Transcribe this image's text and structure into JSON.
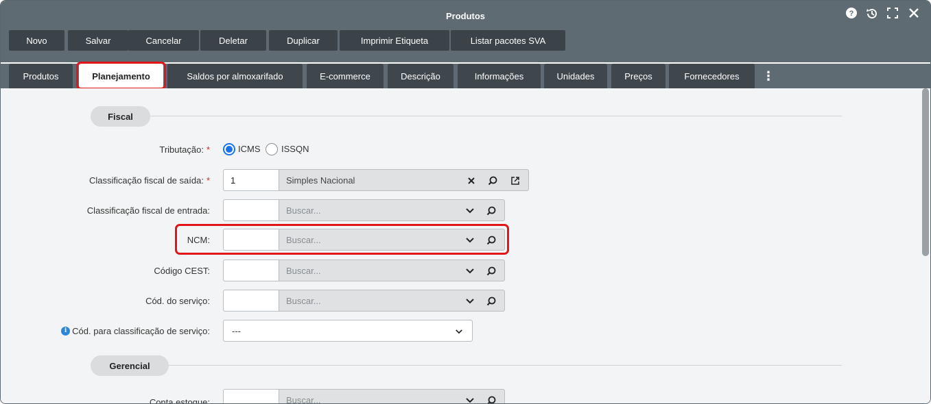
{
  "window": {
    "title": "Produtos"
  },
  "window_controls": [
    "help-icon",
    "history-icon",
    "fullscreen-icon",
    "close-icon"
  ],
  "toolbar": {
    "buttons": [
      "Novo",
      "Salvar",
      "Cancelar",
      "Deletar",
      "Duplicar",
      "Imprimir Etiqueta",
      "Listar pacotes SVA"
    ]
  },
  "tabs": {
    "items": [
      "Produtos",
      "Planejamento",
      "Saldos por almoxarifado",
      "E-commerce",
      "Descrição",
      "Informações",
      "Unidades",
      "Preços",
      "Fornecedores"
    ],
    "active": "Planejamento",
    "more": "⋮"
  },
  "sections": {
    "fiscal": "Fiscal",
    "gerencial": "Gerencial"
  },
  "fields": {
    "tributacao": {
      "label": "Tributação:",
      "required": "*",
      "options": [
        "ICMS",
        "ISSQN"
      ],
      "selected": "ICMS"
    },
    "class_saida": {
      "label": "Classificação fiscal de saída:",
      "required": "*",
      "code": "1",
      "value": "Simples Nacional"
    },
    "class_entrada": {
      "label": "Classificação fiscal de entrada:",
      "code": "",
      "placeholder": "Buscar..."
    },
    "ncm": {
      "label": "NCM:",
      "code": "",
      "placeholder": "Buscar..."
    },
    "cest": {
      "label": "Código CEST:",
      "code": "",
      "placeholder": "Buscar..."
    },
    "cod_servico": {
      "label": "Cód. do serviço:",
      "code": "",
      "placeholder": "Buscar..."
    },
    "class_servico": {
      "label": "Cód. para classificação de serviço:",
      "value": "---"
    },
    "conta_estoque": {
      "label": "Conta estoque:",
      "code": "",
      "placeholder": "Buscar..."
    }
  },
  "colors": {
    "titlebar": "#5f6b73",
    "button_dark": "#3b4248",
    "highlight": "#e0161a",
    "radio_selected": "#1a73e8",
    "required": "#d9262b"
  }
}
